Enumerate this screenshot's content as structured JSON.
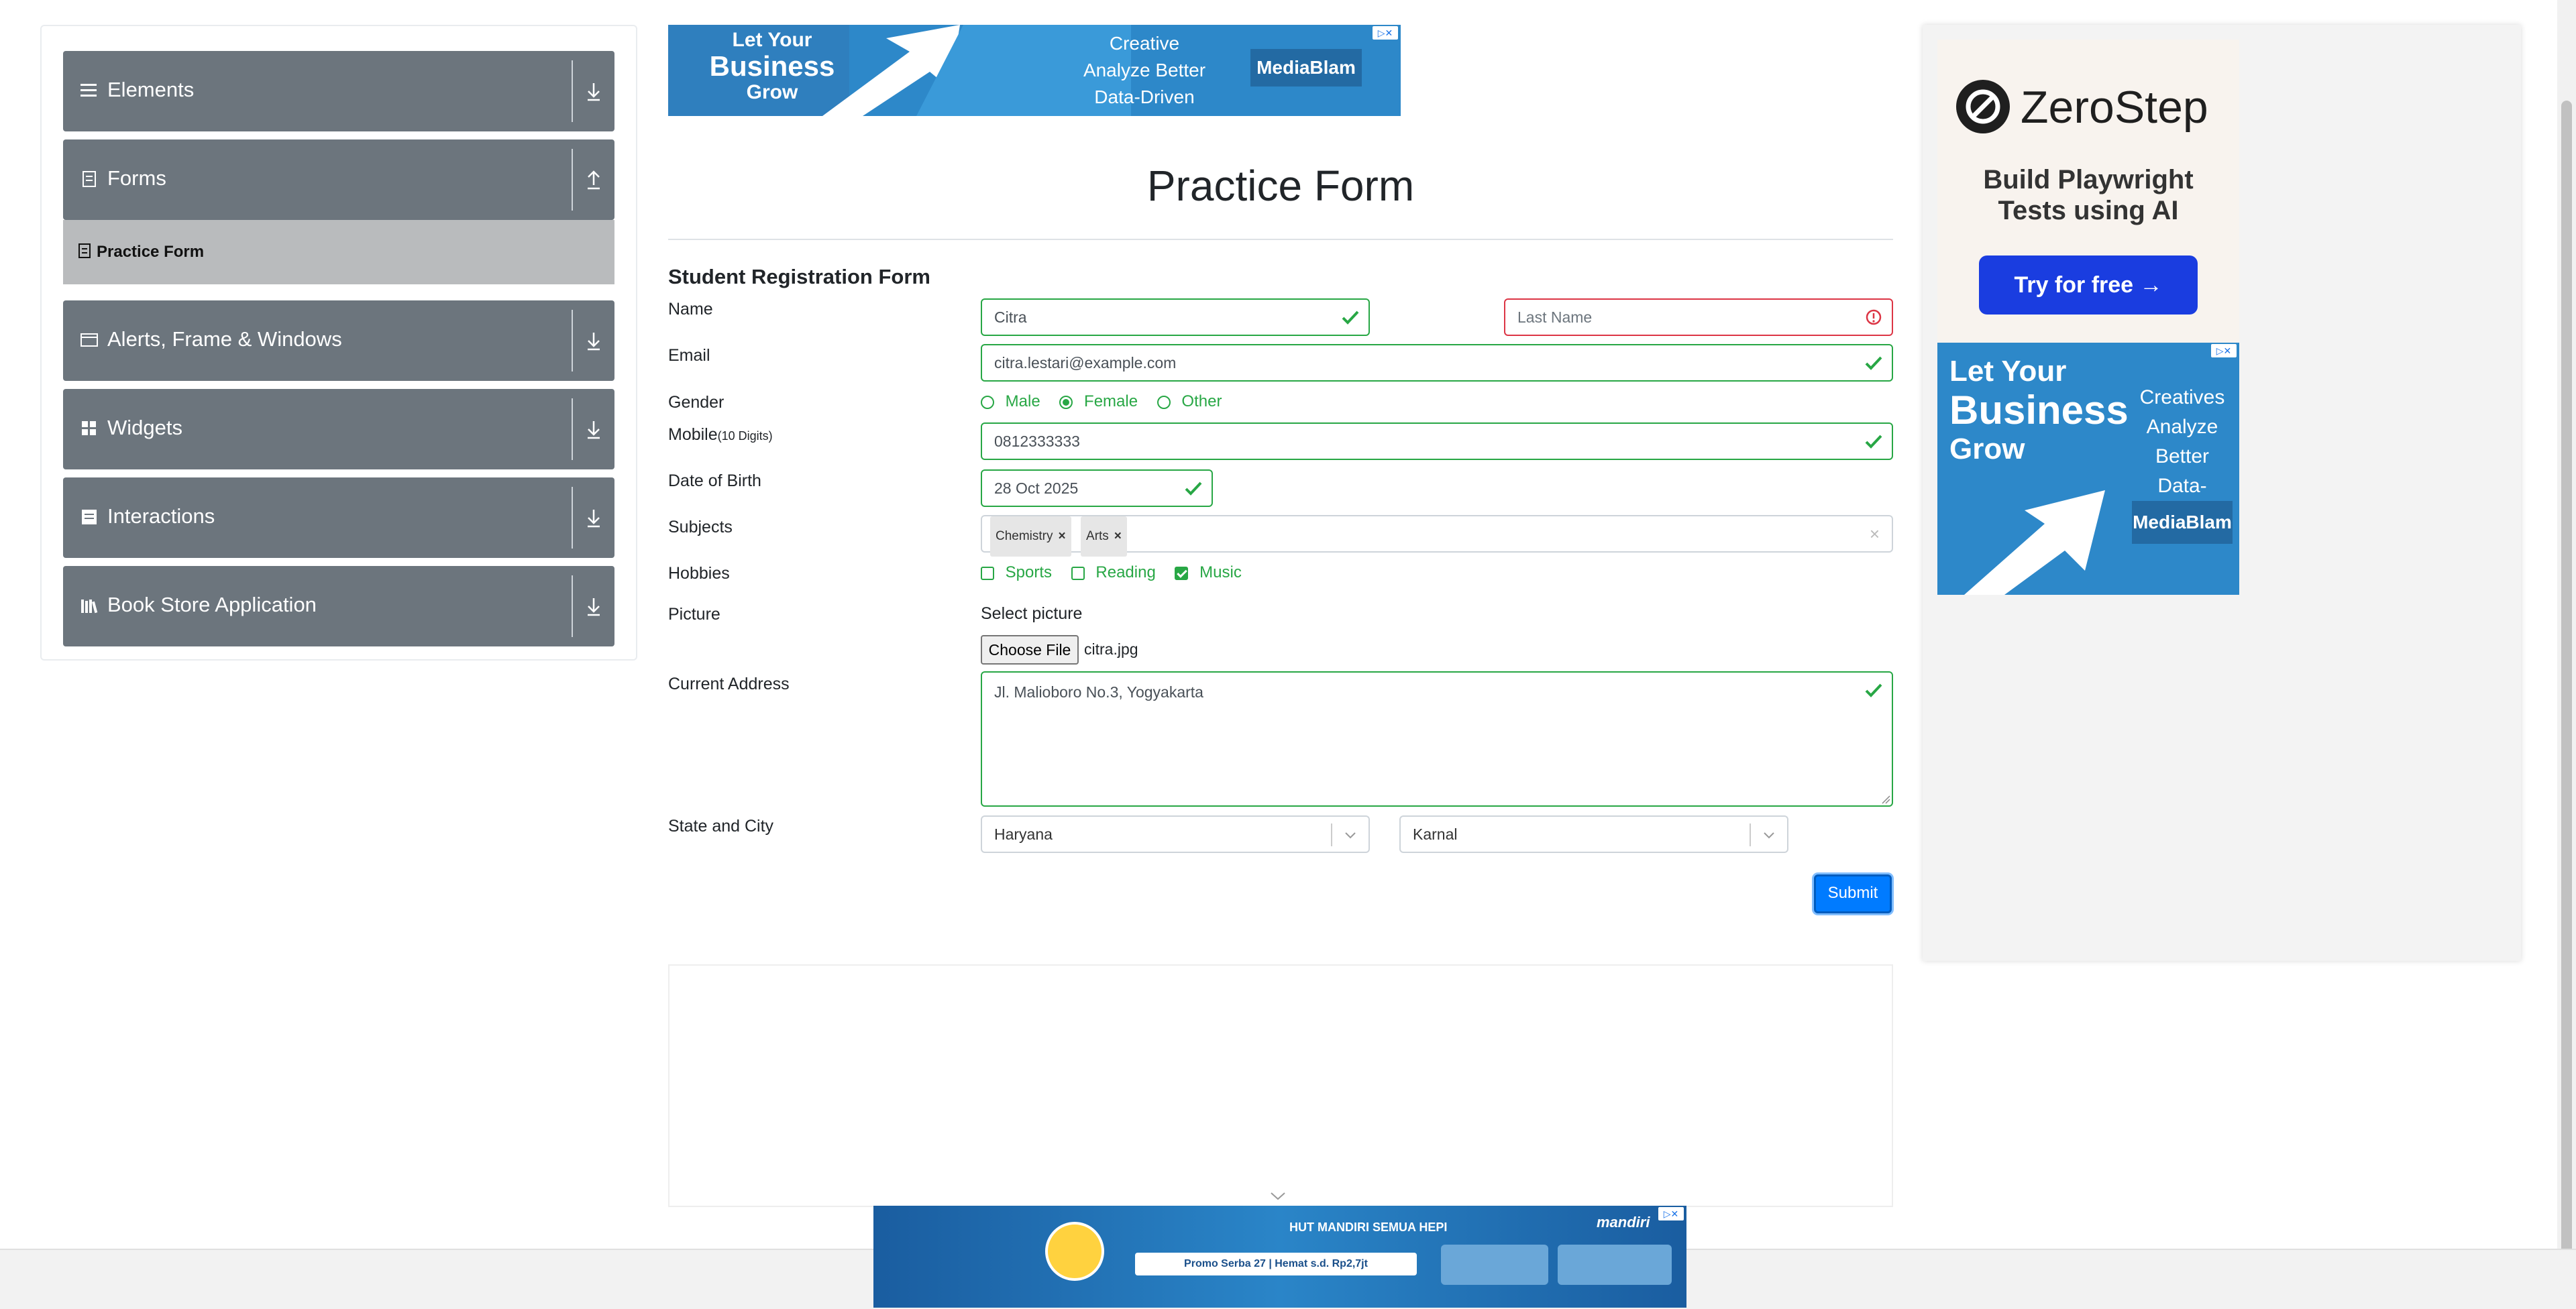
{
  "sidebar": {
    "groups": [
      {
        "label": "Elements"
      },
      {
        "label": "Forms"
      },
      {
        "label": "Alerts, Frame & Windows"
      },
      {
        "label": "Widgets"
      },
      {
        "label": "Interactions"
      },
      {
        "label": "Book Store Application"
      }
    ],
    "active_item": "Practice Form"
  },
  "ads": {
    "top": {
      "line1": "Let Your",
      "line2": "Business",
      "line3": "Grow",
      "tag1": "Creative",
      "tag2": "Analyze Better",
      "tag3": "Data-Driven",
      "brand": "MediaBlam"
    },
    "zerostep": {
      "brand": "ZeroStep",
      "headline": "Build Playwright Tests using AI",
      "cta": "Try for free →"
    },
    "right2": {
      "line1": "Let Your",
      "line2": "Business",
      "line3": "Grow",
      "tag1": "Creatives",
      "tag2": "Analyze Better",
      "tag3": "Data-Driven",
      "brand": "MediaBlam"
    },
    "bottom": {
      "headline": "HUT MANDIRI SEMUA HEPI",
      "brand": "mandiri",
      "promo1": "Promo Serba 27",
      "promo2": "Hemat s.d. Rp2,7jt"
    }
  },
  "form": {
    "title": "Practice Form",
    "subtitle": "Student Registration Form",
    "labels": {
      "name": "Name",
      "email": "Email",
      "gender": "Gender",
      "mobile": "Mobile",
      "mobile_hint": "(10 Digits)",
      "dob": "Date of Birth",
      "subjects": "Subjects",
      "hobbies": "Hobbies",
      "picture": "Picture",
      "address": "Current Address",
      "state_city": "State and City"
    },
    "first_name": "Citra",
    "last_name_placeholder": "Last Name",
    "email": "citra.lestari@example.com",
    "gender_options": [
      "Male",
      "Female",
      "Other"
    ],
    "gender_selected": "Female",
    "mobile": "0812333333",
    "dob": "28 Oct 2025",
    "subjects": [
      "Chemistry",
      "Arts"
    ],
    "hobbies": [
      {
        "label": "Sports",
        "checked": false
      },
      {
        "label": "Reading",
        "checked": false
      },
      {
        "label": "Music",
        "checked": true
      }
    ],
    "picture_label": "Select picture",
    "choose_file": "Choose File",
    "file_name": "citra.jpg",
    "address_value": "Jl. Malioboro No.3, Yogyakarta",
    "state": "Haryana",
    "city": "Karnal",
    "submit": "Submit"
  },
  "colors": {
    "valid": "#28a745",
    "invalid": "#dc3545",
    "primary": "#007bff",
    "sidebar": "#6c757d"
  }
}
